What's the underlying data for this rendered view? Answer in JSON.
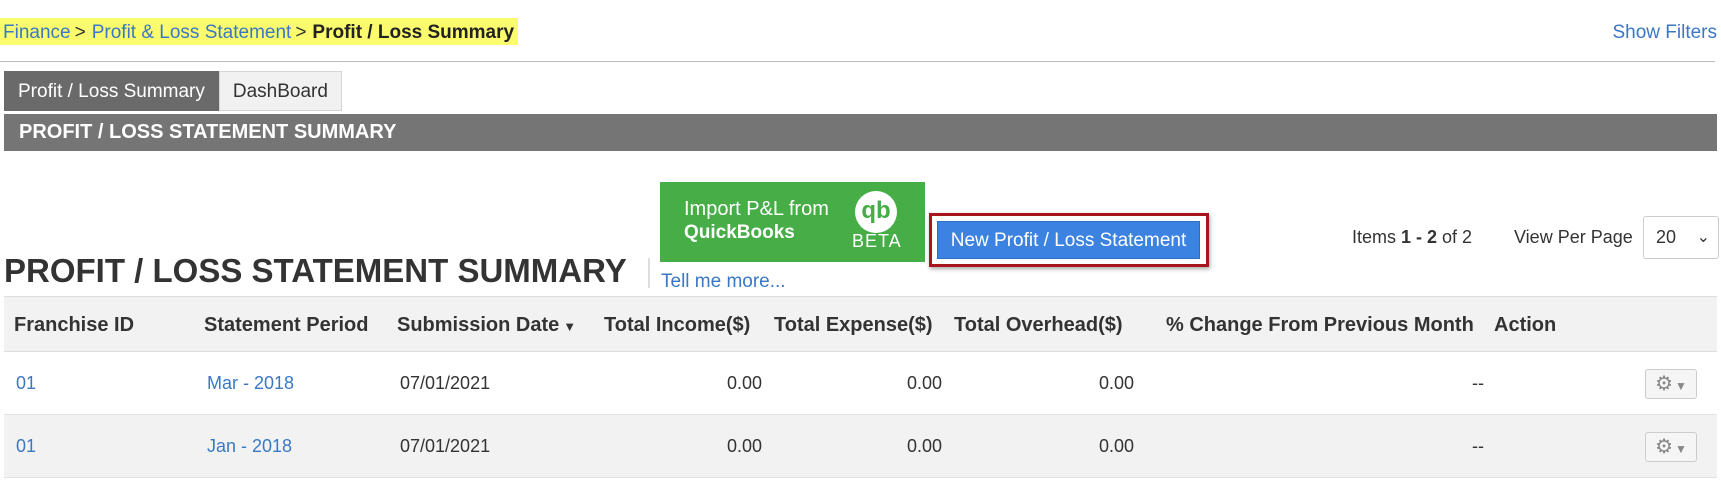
{
  "breadcrumb": {
    "items": [
      "Finance",
      "Profit & Loss Statement"
    ],
    "separator": ">",
    "current": "Profit / Loss Summary"
  },
  "header": {
    "show_filters": "Show  Filters"
  },
  "tabs": [
    {
      "label": "Profit / Loss Summary",
      "active": true
    },
    {
      "label": "DashBoard",
      "active": false
    }
  ],
  "section_bar": {
    "title": "PROFIT / LOSS STATEMENT SUMMARY"
  },
  "quickbooks": {
    "line1": "Import P&L from",
    "line2": "QuickBooks",
    "logo": "qb",
    "badge": "BETA",
    "tell_more": "Tell me more...",
    "color": "#46ad47"
  },
  "actions": {
    "new_statement": "New Profit / Loss Statement"
  },
  "page_title": "PROFIT / LOSS STATEMENT SUMMARY",
  "pagination": {
    "items_prefix": "Items ",
    "range": "1 - 2",
    "of": " of 2",
    "view_per_page_label": "View Per Page",
    "per_page": "20"
  },
  "table": {
    "columns": [
      "Franchise ID",
      "Statement Period",
      "Submission Date",
      "Total Income($)",
      "Total Expense($)",
      "Total Overhead($)",
      "% Change From Previous Month",
      "Action"
    ],
    "rows": [
      {
        "franchise_id": "01",
        "period": "Mar - 2018",
        "submission_date": "07/01/2021",
        "income": "0.00",
        "expense": "0.00",
        "overhead": "0.00",
        "change": "--"
      },
      {
        "franchise_id": "01",
        "period": "Jan - 2018",
        "submission_date": "07/01/2021",
        "income": "0.00",
        "expense": "0.00",
        "overhead": "0.00",
        "change": "--"
      }
    ]
  },
  "colors": {
    "link": "#3a78c6",
    "highlight": "#fbfb6e",
    "section_bar": "#767576",
    "primary_button": "#3c82e0",
    "focus_border": "#a8161b"
  }
}
